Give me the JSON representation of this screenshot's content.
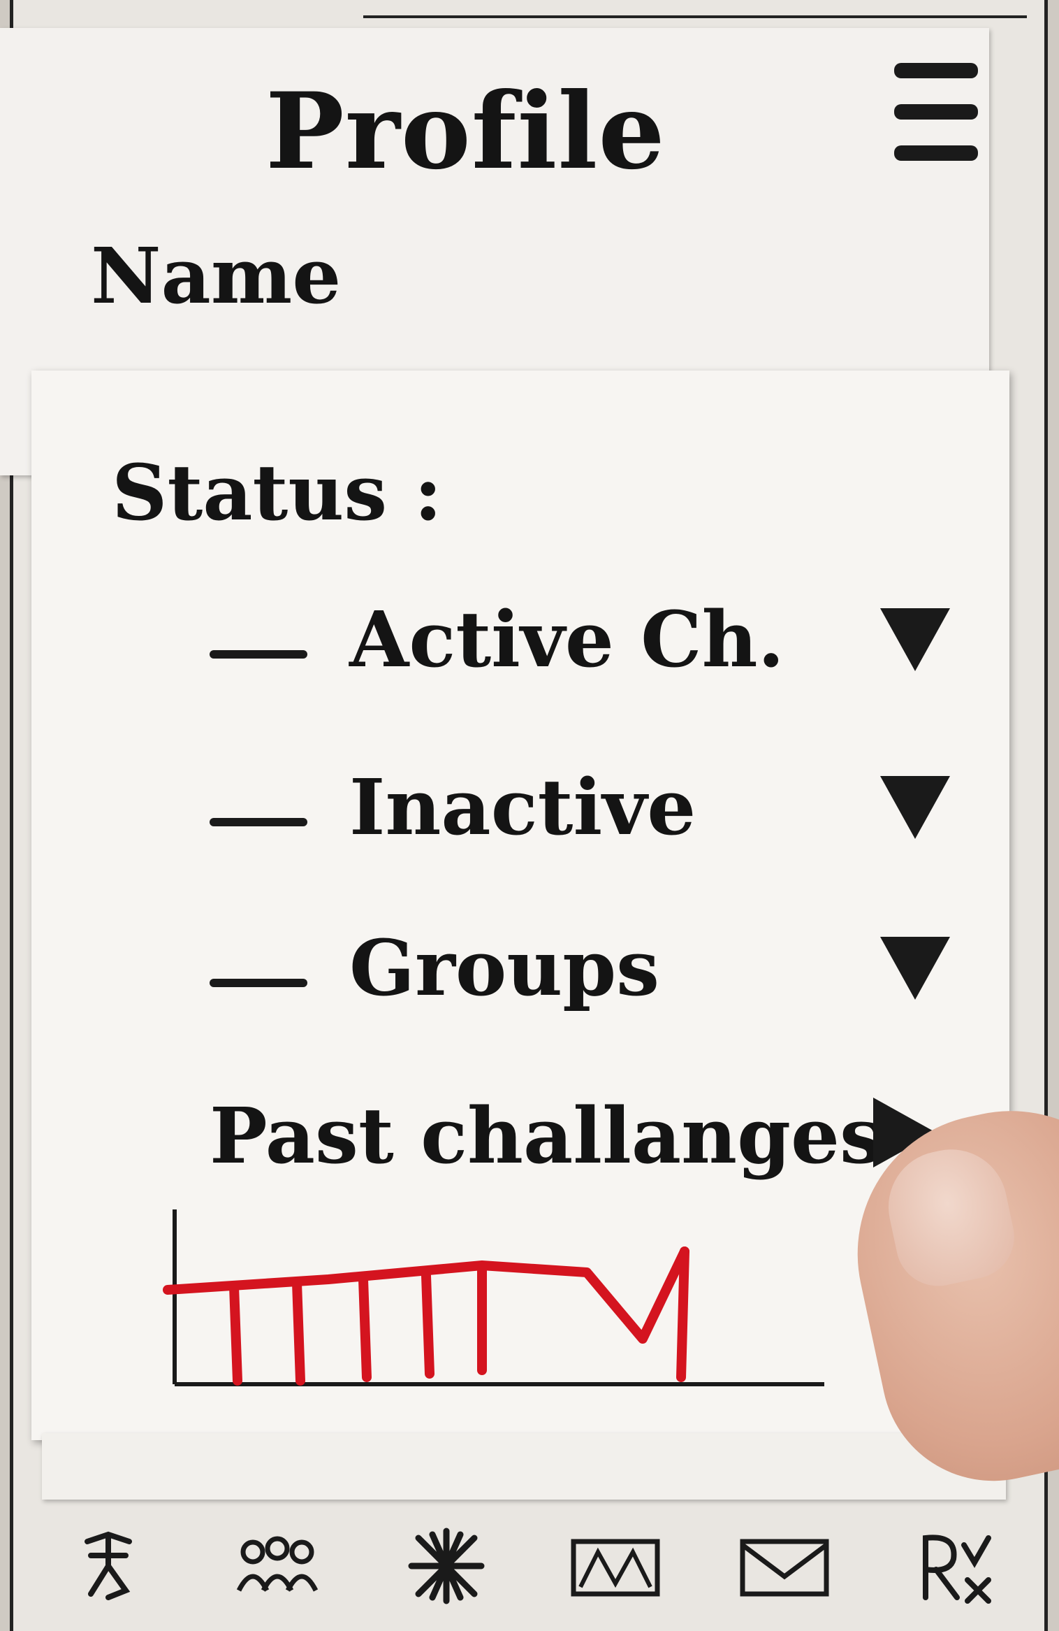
{
  "header": {
    "title": "Profile",
    "menu_icon": "hamburger-menu-icon"
  },
  "profile": {
    "name_label": "Name",
    "name_value": ""
  },
  "status": {
    "label": "Status :",
    "items": [
      {
        "label": "Active Ch.",
        "icon": "triangle-down-icon"
      },
      {
        "label": "Inactive",
        "icon": "triangle-down-icon"
      },
      {
        "label": "Groups",
        "icon": "triangle-down-icon"
      }
    ]
  },
  "past_challenges": {
    "label": "Past challanges",
    "icon": "triangle-right-icon"
  },
  "colors": {
    "ink": "#1a1a1a",
    "chart_red": "#d4141f",
    "paper": "#f7f5f2"
  },
  "bottom_nav": [
    {
      "name": "nav-person-icon"
    },
    {
      "name": "nav-group-icon"
    },
    {
      "name": "nav-burst-icon"
    },
    {
      "name": "nav-map-icon"
    },
    {
      "name": "nav-mail-icon"
    },
    {
      "name": "nav-rx-icon"
    }
  ]
}
